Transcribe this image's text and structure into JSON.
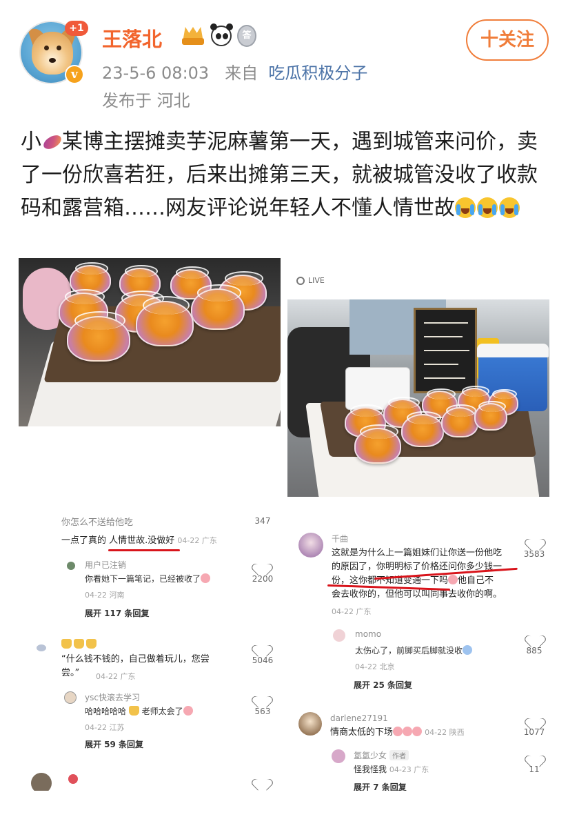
{
  "user": {
    "name": "王落北",
    "plus_badge": "+1",
    "verified_mark": "v",
    "medal_text": "答",
    "time": "23-5-6 08:03",
    "from_label": "来自",
    "source": "吃瓜积极分子",
    "location": "发布于 河北",
    "follow_label": "十关注"
  },
  "post": {
    "prefix": "小",
    "text": "某博主摆摊卖芋泥麻薯第一天，遇到城管来问价，卖了一份欣喜若狂，后来出摊第三天，就被城管没收了收款码和露营箱……网友评论说年轻人不懂人情世故"
  },
  "photos": {
    "live_label": "LIVE"
  },
  "comments_left": {
    "top_line": "你怎么不送给他吃",
    "c1_text_a": "一点了真的 ",
    "c1_text_b": "人情世故.没做好",
    "c1_meta": "04-22 广东",
    "c1_likes": "347",
    "r1_name": "用户已注销",
    "r1_text": "你看她下一篇笔记，已经被收了",
    "r1_meta": "04-22 河南",
    "r1_likes": "2200",
    "r1_expand": "展开 117 条回复",
    "c2_text": "“什么钱不钱的，自己做着玩儿，您尝尝。”",
    "c2_meta": "04-22 广东",
    "c2_likes": "5046",
    "r2_name": "ysc快滚去学习",
    "r2_text": "哈哈哈哈哈",
    "r2_text_b": "老师太会了",
    "r2_meta": "04-22 江苏",
    "r2_likes": "563",
    "r2_expand": "展开 59 条回复"
  },
  "comments_right": {
    "c1_name": "千曲",
    "c1_line1": "这就是为什么上一篇姐妹们让你送一份他吃",
    "c1_line2_a": "的原因了，",
    "c1_line2_b": "你明明标了价格还问你多少钱一",
    "c1_line3_a": "份，这你都",
    "c1_line3_b": "不知道变通一下吗",
    "c1_line3_c": "他自己不",
    "c1_line4": "会去收你的，但他可以叫同事去收你的啊。",
    "c1_meta": "04-22 广东",
    "c1_likes": "3583",
    "c2_name": "momo",
    "c2_text": "太伤心了，前脚买后脚就没收",
    "c2_meta": "04-22 北京",
    "c2_likes": "885",
    "c2_expand": "展开 25 条回复",
    "c3_name": "darlene27191",
    "c3_text": "情商太低的下场",
    "c3_meta": "04-22 陕西",
    "c3_likes": "1077",
    "r3_name": "氲氲少女",
    "r3_tag": "作者",
    "r3_text": "怪我怪我",
    "r3_meta": "04-23 广东",
    "r3_likes": "11",
    "r3_expand": "展开 7 条回复"
  },
  "colors": {
    "username": "#f2652d",
    "source_link": "#4d74a8",
    "follow": "#f07d3a",
    "underline": "#d8141b"
  }
}
